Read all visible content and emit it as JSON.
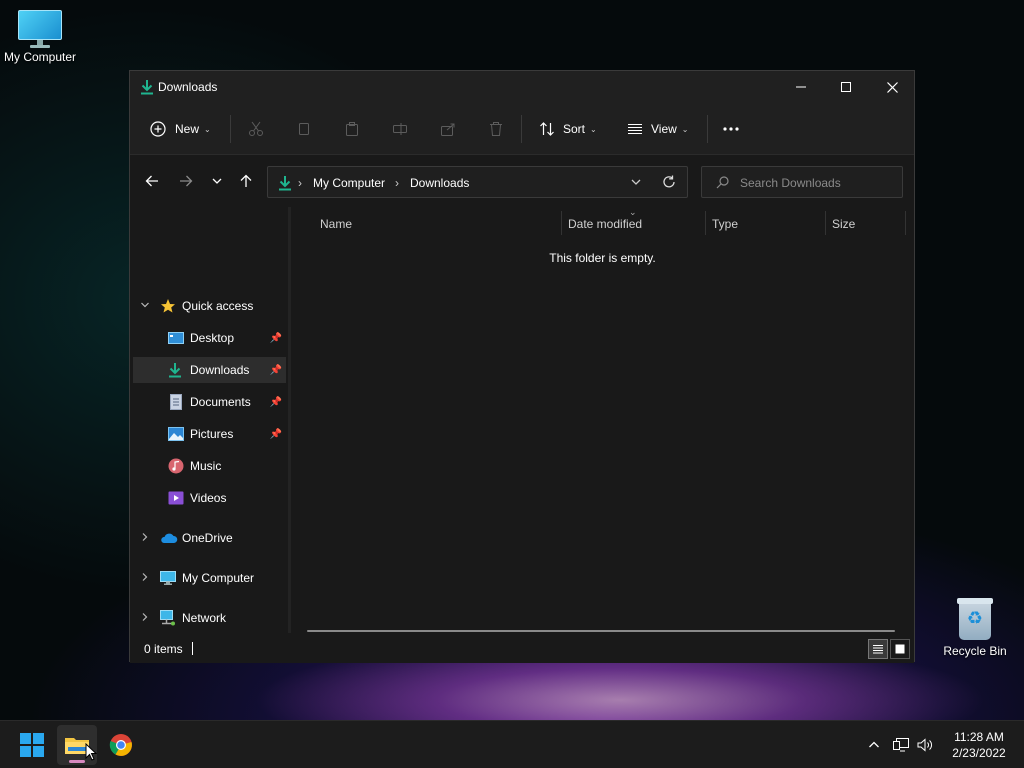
{
  "desktop": {
    "icons": [
      {
        "label": "My Computer"
      },
      {
        "label": "Recycle Bin"
      }
    ]
  },
  "window": {
    "title": "Downloads",
    "commands": {
      "new_label": "New",
      "sort_label": "Sort",
      "view_label": "View"
    },
    "address": {
      "crumbs": [
        "My Computer",
        "Downloads"
      ]
    },
    "search": {
      "placeholder": "Search Downloads"
    },
    "nav_pane": {
      "quick_access": "Quick access",
      "quick_items": [
        {
          "label": "Desktop",
          "pinned": true
        },
        {
          "label": "Downloads",
          "pinned": true,
          "selected": true
        },
        {
          "label": "Documents",
          "pinned": true
        },
        {
          "label": "Pictures",
          "pinned": true
        },
        {
          "label": "Music",
          "pinned": false
        },
        {
          "label": "Videos",
          "pinned": false
        }
      ],
      "roots": [
        {
          "label": "OneDrive"
        },
        {
          "label": "My Computer"
        },
        {
          "label": "Network"
        }
      ]
    },
    "columns": [
      "Name",
      "Date modified",
      "Type",
      "Size"
    ],
    "empty_message": "This folder is empty.",
    "status": {
      "item_count": "0 items"
    }
  },
  "taskbar": {
    "clock": {
      "time": "11:28 AM",
      "date": "2/23/2022"
    }
  },
  "colors": {
    "accent": "#1fb58f",
    "window_bg": "#191919",
    "titlebar_bg": "#202020",
    "taskbar_bg": "#1c1c1c"
  }
}
